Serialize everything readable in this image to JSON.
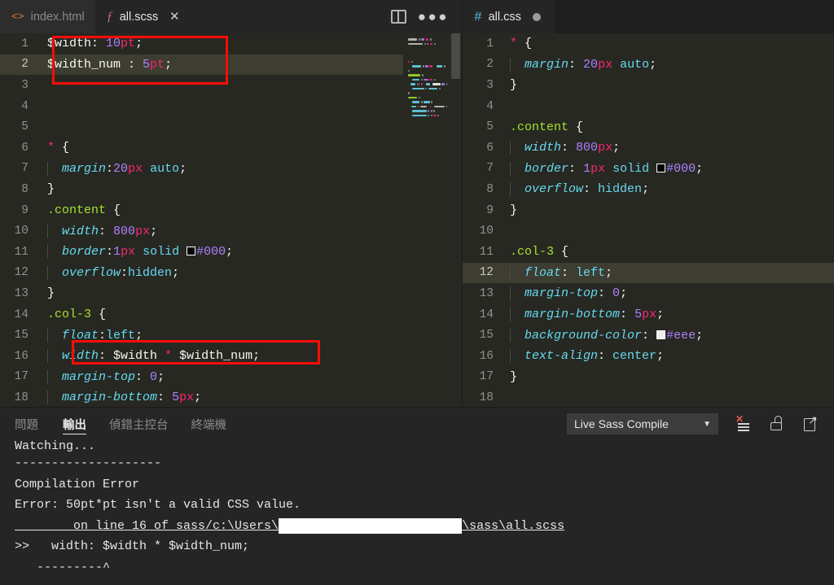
{
  "window": {
    "title": "Visual Studio Code"
  },
  "left_group": {
    "tabs": [
      {
        "name": "index.html",
        "icon": "html-file-icon",
        "icon_glyph": "<>",
        "active": false,
        "dirty": false
      },
      {
        "name": "all.scss",
        "icon": "sass-file-icon",
        "icon_glyph": "ƒ",
        "active": true,
        "dirty": false,
        "close_glyph": "✕"
      }
    ],
    "actions": [
      {
        "name": "split-editor-icon",
        "label": "Split Editor"
      },
      {
        "name": "more-actions-icon",
        "label": "•••"
      }
    ],
    "active_line": 2,
    "code": [
      {
        "n": 1,
        "tokens": [
          {
            "t": "$width",
            "c": "t-var"
          },
          {
            "t": ": ",
            "c": "t-punct"
          },
          {
            "t": "10",
            "c": "t-num"
          },
          {
            "t": "pt",
            "c": "t-unit"
          },
          {
            "t": ";",
            "c": "t-punct"
          }
        ]
      },
      {
        "n": 2,
        "tokens": [
          {
            "t": "$width_num",
            "c": "t-var"
          },
          {
            "t": " : ",
            "c": "t-punct"
          },
          {
            "t": "5",
            "c": "t-num"
          },
          {
            "t": "pt",
            "c": "t-unit"
          },
          {
            "t": ";",
            "c": "t-punct"
          }
        ]
      },
      {
        "n": 3,
        "tokens": []
      },
      {
        "n": 4,
        "tokens": []
      },
      {
        "n": 5,
        "tokens": []
      },
      {
        "n": 6,
        "tokens": [
          {
            "t": "*",
            "c": "t-star"
          },
          {
            "t": " {",
            "c": "t-punct"
          }
        ]
      },
      {
        "n": 7,
        "indent": 1,
        "tokens": [
          {
            "t": "  ",
            "c": "t-punct"
          },
          {
            "t": "margin",
            "c": "t-prop"
          },
          {
            "t": ":",
            "c": "t-punct"
          },
          {
            "t": "20",
            "c": "t-num"
          },
          {
            "t": "px",
            "c": "t-unit"
          },
          {
            "t": " ",
            "c": "t-punct"
          },
          {
            "t": "auto",
            "c": "t-val"
          },
          {
            "t": ";",
            "c": "t-punct"
          }
        ]
      },
      {
        "n": 8,
        "tokens": [
          {
            "t": "}",
            "c": "t-punct"
          }
        ]
      },
      {
        "n": 9,
        "tokens": [
          {
            "t": ".content",
            "c": "t-sel"
          },
          {
            "t": " {",
            "c": "t-punct"
          }
        ]
      },
      {
        "n": 10,
        "indent": 1,
        "tokens": [
          {
            "t": "  ",
            "c": "t-punct"
          },
          {
            "t": "width",
            "c": "t-prop"
          },
          {
            "t": ": ",
            "c": "t-punct"
          },
          {
            "t": "800",
            "c": "t-num"
          },
          {
            "t": "px",
            "c": "t-unit"
          },
          {
            "t": ";",
            "c": "t-punct"
          }
        ]
      },
      {
        "n": 11,
        "indent": 1,
        "tokens": [
          {
            "t": "  ",
            "c": "t-punct"
          },
          {
            "t": "border",
            "c": "t-prop"
          },
          {
            "t": ":",
            "c": "t-punct"
          },
          {
            "t": "1",
            "c": "t-num"
          },
          {
            "t": "px",
            "c": "t-unit"
          },
          {
            "t": " ",
            "c": "t-punct"
          },
          {
            "t": "solid",
            "c": "t-val"
          },
          {
            "t": " ",
            "c": "t-punct"
          },
          {
            "t": "__SWATCH__",
            "c": "swatch-000"
          },
          {
            "t": "#000",
            "c": "t-hex"
          },
          {
            "t": ";",
            "c": "t-punct"
          }
        ]
      },
      {
        "n": 12,
        "indent": 1,
        "tokens": [
          {
            "t": "  ",
            "c": "t-punct"
          },
          {
            "t": "overflow",
            "c": "t-prop"
          },
          {
            "t": ":",
            "c": "t-punct"
          },
          {
            "t": "hidden",
            "c": "t-val"
          },
          {
            "t": ";",
            "c": "t-punct"
          }
        ]
      },
      {
        "n": 13,
        "tokens": [
          {
            "t": "}",
            "c": "t-punct"
          }
        ]
      },
      {
        "n": 14,
        "tokens": [
          {
            "t": ".col-3",
            "c": "t-sel"
          },
          {
            "t": " {",
            "c": "t-punct"
          }
        ]
      },
      {
        "n": 15,
        "indent": 1,
        "tokens": [
          {
            "t": "  ",
            "c": "t-punct"
          },
          {
            "t": "float",
            "c": "t-prop"
          },
          {
            "t": ":",
            "c": "t-punct"
          },
          {
            "t": "left",
            "c": "t-val"
          },
          {
            "t": ";",
            "c": "t-punct"
          }
        ]
      },
      {
        "n": 16,
        "indent": 1,
        "tokens": [
          {
            "t": "  ",
            "c": "t-punct"
          },
          {
            "t": "width",
            "c": "t-prop"
          },
          {
            "t": ": ",
            "c": "t-punct"
          },
          {
            "t": "$width",
            "c": "t-var"
          },
          {
            "t": " ",
            "c": "t-punct"
          },
          {
            "t": "*",
            "c": "t-op"
          },
          {
            "t": " ",
            "c": "t-punct"
          },
          {
            "t": "$width_num",
            "c": "t-var"
          },
          {
            "t": ";",
            "c": "t-punct"
          }
        ]
      },
      {
        "n": 17,
        "indent": 1,
        "tokens": [
          {
            "t": "  ",
            "c": "t-punct"
          },
          {
            "t": "margin-top",
            "c": "t-prop"
          },
          {
            "t": ": ",
            "c": "t-punct"
          },
          {
            "t": "0",
            "c": "t-num"
          },
          {
            "t": ";",
            "c": "t-punct"
          }
        ]
      },
      {
        "n": 18,
        "indent": 1,
        "tokens": [
          {
            "t": "  ",
            "c": "t-punct"
          },
          {
            "t": "margin-bottom",
            "c": "t-prop"
          },
          {
            "t": ": ",
            "c": "t-punct"
          },
          {
            "t": "5",
            "c": "t-num"
          },
          {
            "t": "px",
            "c": "t-unit"
          },
          {
            "t": ";",
            "c": "t-punct"
          }
        ]
      }
    ]
  },
  "right_group": {
    "tabs": [
      {
        "name": "all.css",
        "icon": "css-file-icon",
        "icon_glyph": "#",
        "active": true,
        "dirty": true
      }
    ],
    "active_line": 12,
    "code": [
      {
        "n": 1,
        "tokens": [
          {
            "t": "*",
            "c": "t-star"
          },
          {
            "t": " {",
            "c": "t-punct"
          }
        ]
      },
      {
        "n": 2,
        "indent": 1,
        "tokens": [
          {
            "t": "  ",
            "c": "t-punct"
          },
          {
            "t": "margin",
            "c": "t-prop"
          },
          {
            "t": ": ",
            "c": "t-punct"
          },
          {
            "t": "20",
            "c": "t-num"
          },
          {
            "t": "px",
            "c": "t-unit"
          },
          {
            "t": " ",
            "c": "t-punct"
          },
          {
            "t": "auto",
            "c": "t-val"
          },
          {
            "t": ";",
            "c": "t-punct"
          }
        ]
      },
      {
        "n": 3,
        "tokens": [
          {
            "t": "}",
            "c": "t-punct"
          }
        ]
      },
      {
        "n": 4,
        "tokens": []
      },
      {
        "n": 5,
        "tokens": [
          {
            "t": ".content",
            "c": "t-sel"
          },
          {
            "t": " {",
            "c": "t-punct"
          }
        ]
      },
      {
        "n": 6,
        "indent": 1,
        "tokens": [
          {
            "t": "  ",
            "c": "t-punct"
          },
          {
            "t": "width",
            "c": "t-prop"
          },
          {
            "t": ": ",
            "c": "t-punct"
          },
          {
            "t": "800",
            "c": "t-num"
          },
          {
            "t": "px",
            "c": "t-unit"
          },
          {
            "t": ";",
            "c": "t-punct"
          }
        ]
      },
      {
        "n": 7,
        "indent": 1,
        "tokens": [
          {
            "t": "  ",
            "c": "t-punct"
          },
          {
            "t": "border",
            "c": "t-prop"
          },
          {
            "t": ": ",
            "c": "t-punct"
          },
          {
            "t": "1",
            "c": "t-num"
          },
          {
            "t": "px",
            "c": "t-unit"
          },
          {
            "t": " ",
            "c": "t-punct"
          },
          {
            "t": "solid",
            "c": "t-val"
          },
          {
            "t": " ",
            "c": "t-punct"
          },
          {
            "t": "__SWATCH__",
            "c": "swatch-000"
          },
          {
            "t": "#000",
            "c": "t-hex"
          },
          {
            "t": ";",
            "c": "t-punct"
          }
        ]
      },
      {
        "n": 8,
        "indent": 1,
        "tokens": [
          {
            "t": "  ",
            "c": "t-punct"
          },
          {
            "t": "overflow",
            "c": "t-prop"
          },
          {
            "t": ": ",
            "c": "t-punct"
          },
          {
            "t": "hidden",
            "c": "t-val"
          },
          {
            "t": ";",
            "c": "t-punct"
          }
        ]
      },
      {
        "n": 9,
        "tokens": [
          {
            "t": "}",
            "c": "t-punct"
          }
        ]
      },
      {
        "n": 10,
        "tokens": []
      },
      {
        "n": 11,
        "tokens": [
          {
            "t": ".col-3",
            "c": "t-sel"
          },
          {
            "t": " {",
            "c": "t-punct"
          }
        ]
      },
      {
        "n": 12,
        "indent": 1,
        "tokens": [
          {
            "t": "  ",
            "c": "t-punct"
          },
          {
            "t": "float",
            "c": "t-prop"
          },
          {
            "t": ": ",
            "c": "t-punct"
          },
          {
            "t": "left",
            "c": "t-val"
          },
          {
            "t": ";",
            "c": "t-punct"
          }
        ]
      },
      {
        "n": 13,
        "indent": 1,
        "tokens": [
          {
            "t": "  ",
            "c": "t-punct"
          },
          {
            "t": "margin-top",
            "c": "t-prop"
          },
          {
            "t": ": ",
            "c": "t-punct"
          },
          {
            "t": "0",
            "c": "t-num"
          },
          {
            "t": ";",
            "c": "t-punct"
          }
        ]
      },
      {
        "n": 14,
        "indent": 1,
        "tokens": [
          {
            "t": "  ",
            "c": "t-punct"
          },
          {
            "t": "margin-bottom",
            "c": "t-prop"
          },
          {
            "t": ": ",
            "c": "t-punct"
          },
          {
            "t": "5",
            "c": "t-num"
          },
          {
            "t": "px",
            "c": "t-unit"
          },
          {
            "t": ";",
            "c": "t-punct"
          }
        ]
      },
      {
        "n": 15,
        "indent": 1,
        "tokens": [
          {
            "t": "  ",
            "c": "t-punct"
          },
          {
            "t": "background-color",
            "c": "t-prop"
          },
          {
            "t": ": ",
            "c": "t-punct"
          },
          {
            "t": "__SWATCH_EEE__",
            "c": "swatch-eee"
          },
          {
            "t": "#eee",
            "c": "t-hex"
          },
          {
            "t": ";",
            "c": "t-punct"
          }
        ]
      },
      {
        "n": 16,
        "indent": 1,
        "tokens": [
          {
            "t": "  ",
            "c": "t-punct"
          },
          {
            "t": "text-align",
            "c": "t-prop"
          },
          {
            "t": ": ",
            "c": "t-punct"
          },
          {
            "t": "center",
            "c": "t-val"
          },
          {
            "t": ";",
            "c": "t-punct"
          }
        ]
      },
      {
        "n": 17,
        "tokens": [
          {
            "t": "}",
            "c": "t-punct"
          }
        ]
      },
      {
        "n": 18,
        "tokens": []
      }
    ]
  },
  "panel": {
    "tabs": [
      {
        "label": "問題",
        "active": false
      },
      {
        "label": "輸出",
        "active": true
      },
      {
        "label": "偵錯主控台",
        "active": false
      },
      {
        "label": "終端機",
        "active": false
      }
    ],
    "channel_select": {
      "value": "Live Sass Compile",
      "caret": "▼"
    },
    "actions": [
      {
        "name": "clear-output-icon",
        "label": "Clear Output"
      },
      {
        "name": "lock-scroll-icon",
        "label": "Turn Auto Scrolling Off"
      },
      {
        "name": "open-in-editor-icon",
        "label": "Open Output in Editor"
      }
    ],
    "output": {
      "line_watching": "Watching...",
      "line_divider": "--------------------",
      "line_title": "Compilation Error",
      "line_error": "Error: 50pt*pt isn't a valid CSS value.",
      "line_on_prefix": "        on line 16 of sass/c:\\Users\\",
      "line_on_suffix": "\\sass\\all.scss",
      "line_code_prompt": ">>",
      "line_code": "   width: $width * $width_num;",
      "line_caret": "   ---------^"
    }
  },
  "annotations": {
    "boxes": [
      {
        "name": "variables-highlight-box",
        "color": "#fb0d08"
      },
      {
        "name": "width-expression-highlight-box",
        "color": "#fb0d08"
      }
    ]
  }
}
